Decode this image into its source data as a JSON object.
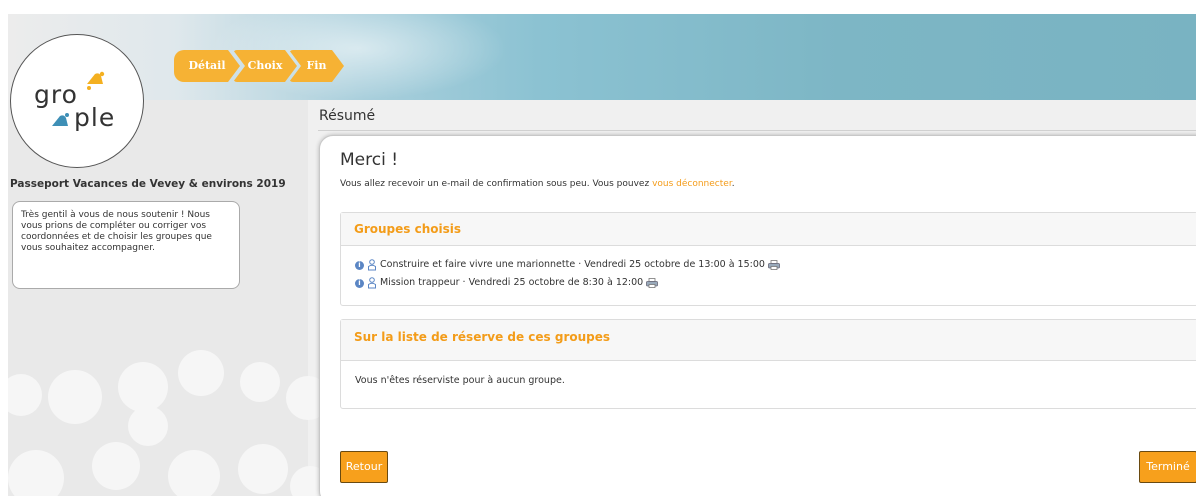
{
  "logo": {
    "line1": "gro",
    "line2": "ple"
  },
  "steps": [
    {
      "label": "Détail"
    },
    {
      "label": "Choix"
    },
    {
      "label": "Fin"
    }
  ],
  "sidebar": {
    "event_title": "Passeport Vacances de Vevey & environs 2019",
    "note": "Très gentil à vous de nous soutenir ! Nous vous prions de compléter ou corriger vos coordonnées et de choisir les groupes que vous souhaitez accompagner."
  },
  "page": {
    "heading": "Résumé"
  },
  "summary": {
    "title": "Merci !",
    "confirm_text": "Vous allez recevoir un e-mail de confirmation sous peu. Vous pouvez ",
    "logout_link": "vous déconnecter",
    "confirm_end": "."
  },
  "chosen_groups": {
    "header": "Groupes choisis",
    "items": [
      {
        "text": "Construire et faire vivre une marionnette · Vendredi 25 octobre de 13:00 à 15:00"
      },
      {
        "text": "Mission trappeur · Vendredi 25 octobre de 8:30 à 12:00"
      }
    ]
  },
  "reserve_groups": {
    "header": "Sur la liste de réserve de ces groupes",
    "empty_text": "Vous n'êtes réserviste pour à aucun groupe."
  },
  "buttons": {
    "back": "Retour",
    "done": "Terminé"
  },
  "colors": {
    "accent": "#f39c19",
    "button": "#f7a01c",
    "banner": "#79b3c2"
  }
}
